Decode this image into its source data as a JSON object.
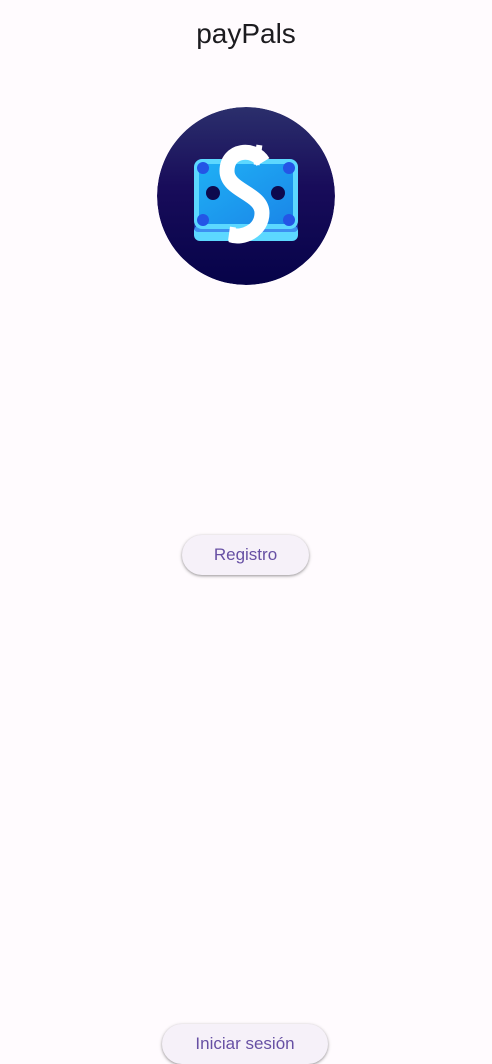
{
  "app": {
    "title": "payPals"
  },
  "logo": {
    "icon": "money-bill-dollar-icon",
    "colors": {
      "background_top": "#2a2d6b",
      "background_bottom": "#08044a",
      "bill_blue": "#1ea3f0",
      "bill_light": "#5cd8ff",
      "bill_dark": "#2455e6",
      "dollar": "#ffffff"
    }
  },
  "actions": {
    "register_label": "Registro",
    "login_label": "Iniciar sesión"
  },
  "theme": {
    "background": "#fffbfe",
    "button_background": "#f6f1f9",
    "button_text": "#6750a4",
    "title_text": "#1c1b1f"
  }
}
